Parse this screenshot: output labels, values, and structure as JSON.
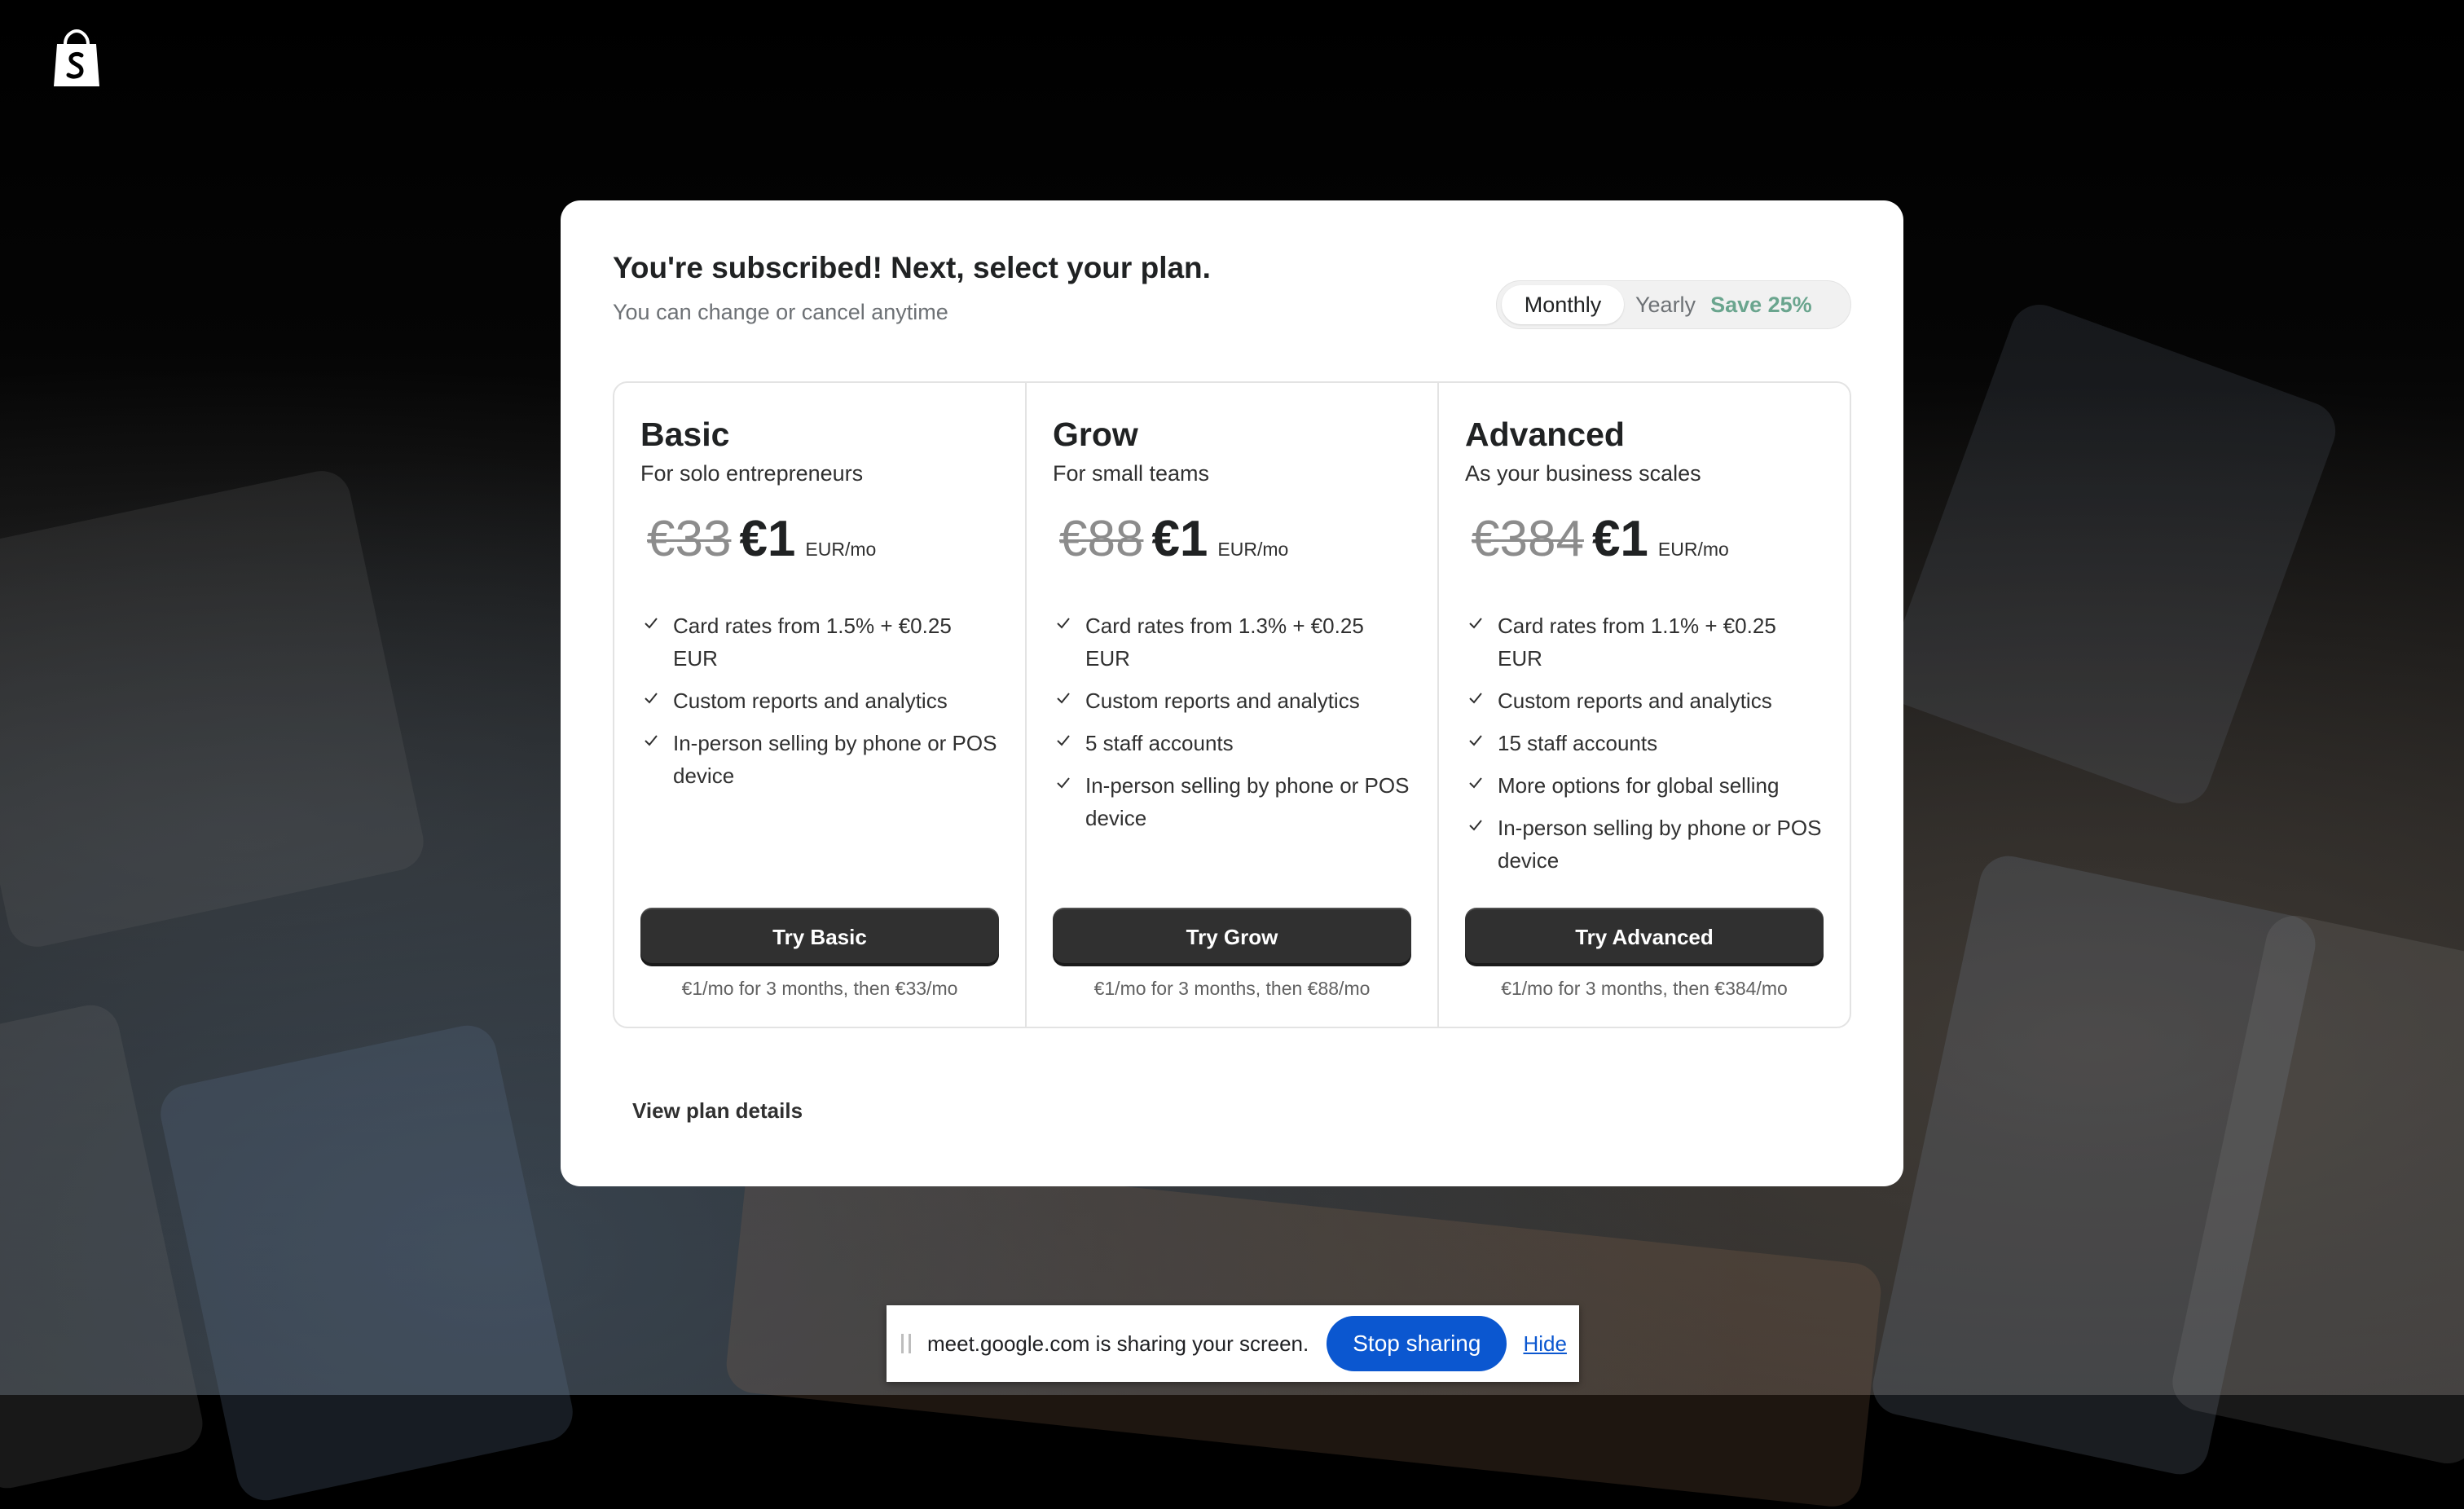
{
  "header": {
    "title": "You're subscribed! Next, select your plan.",
    "subtitle": "You can change or cancel anytime"
  },
  "billing_toggle": {
    "monthly": "Monthly",
    "yearly": "Yearly",
    "save": "Save 25%",
    "selected": "Monthly"
  },
  "plans": [
    {
      "name": "Basic",
      "description": "For solo entrepreneurs",
      "old_price": "€33",
      "price": "€1",
      "period": "EUR/mo",
      "features": [
        "Card rates from 1.5% + €0.25 EUR",
        "Custom reports and analytics",
        "In-person selling by phone or POS device"
      ],
      "button": "Try Basic",
      "note": "€1/mo for 3 months, then €33/mo"
    },
    {
      "name": "Grow",
      "description": "For small teams",
      "old_price": "€88",
      "price": "€1",
      "period": "EUR/mo",
      "features": [
        "Card rates from 1.3% + €0.25 EUR",
        "Custom reports and analytics",
        "5 staff accounts",
        "In-person selling by phone or POS device"
      ],
      "button": "Try Grow",
      "note": "€1/mo for 3 months, then €88/mo"
    },
    {
      "name": "Advanced",
      "description": "As your business scales",
      "old_price": "€384",
      "price": "€1",
      "period": "EUR/mo",
      "features": [
        "Card rates from 1.1% + €0.25 EUR",
        "Custom reports and analytics",
        "15 staff accounts",
        "More options for global selling",
        "In-person selling by phone or POS device"
      ],
      "button": "Try Advanced",
      "note": "€1/mo for 3 months, then €384/mo"
    }
  ],
  "footer_link": "View plan details",
  "share_bar": {
    "message": "meet.google.com is sharing your screen.",
    "stop": "Stop sharing",
    "hide": "Hide"
  },
  "colors": {
    "button": "#303030",
    "save_accent": "#6aa58e",
    "share_blue": "#0b57d0"
  }
}
